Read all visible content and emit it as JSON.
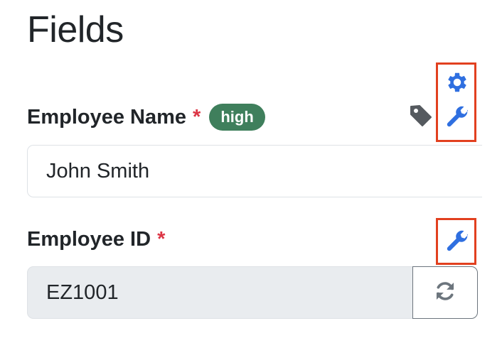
{
  "page": {
    "title": "Fields"
  },
  "fields": [
    {
      "label": "Employee Name",
      "required_mark": "*",
      "badge": "high",
      "value": "John Smith",
      "icons": [
        "tag-icon",
        "gear-icon",
        "wrench-icon"
      ]
    },
    {
      "label": "Employee ID",
      "required_mark": "*",
      "value": "EZ1001",
      "icons": [
        "wrench-icon",
        "refresh-icon"
      ]
    }
  ],
  "colors": {
    "accent_blue": "#2f6fe0",
    "required_red": "#dc3545",
    "badge_green": "#3f7f5c",
    "highlight_red": "#e2401f",
    "readonly_bg": "#e9ecef"
  }
}
